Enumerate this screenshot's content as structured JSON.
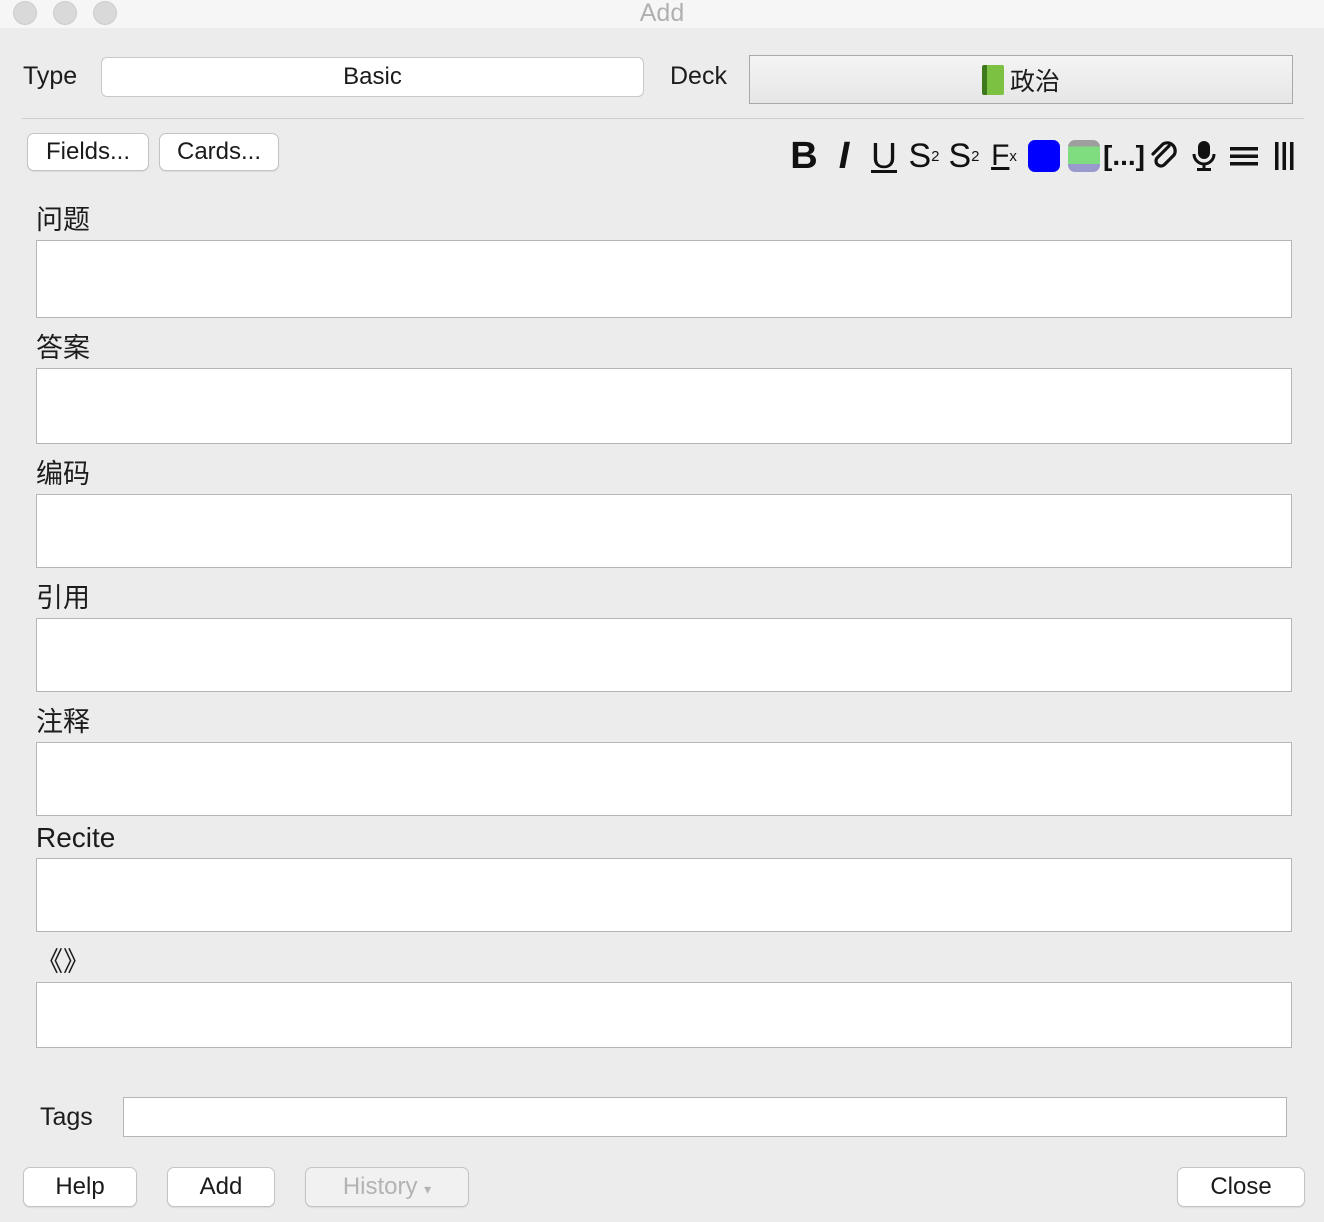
{
  "window": {
    "title": "Add"
  },
  "note_type": {
    "label": "Type",
    "value": "Basic"
  },
  "deck": {
    "label": "Deck",
    "icon": "green-book-icon",
    "value": "政治"
  },
  "buttons": {
    "fields": "Fields...",
    "cards": "Cards..."
  },
  "toolbar": {
    "bold": "B",
    "italic": "I",
    "underline": "U",
    "superscript": "S",
    "superscript_mark": "2",
    "subscript": "S",
    "subscript_mark": "2",
    "clear_format": "F",
    "clear_format_mark": "x",
    "text_color": "#0000ff",
    "cloze": "[...]",
    "attach_icon": "paperclip-icon",
    "record_icon": "microphone-icon",
    "more_icon": "menu-lines-icon",
    "html_icon": "vertical-bars-icon"
  },
  "fields": [
    {
      "label": "问题",
      "value": ""
    },
    {
      "label": "答案",
      "value": ""
    },
    {
      "label": "编码",
      "value": ""
    },
    {
      "label": "引用",
      "value": ""
    },
    {
      "label": "注释",
      "value": ""
    },
    {
      "label": "Recite",
      "value": ""
    },
    {
      "label": "《》",
      "value": ""
    }
  ],
  "tags": {
    "label": "Tags",
    "value": ""
  },
  "footer": {
    "help": "Help",
    "add": "Add",
    "history": "History",
    "history_arrow": "▾",
    "close": "Close"
  }
}
